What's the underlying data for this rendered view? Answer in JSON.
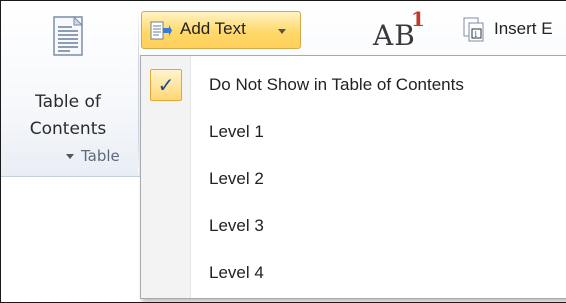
{
  "ribbon": {
    "toc_button": {
      "line1": "Table of",
      "line2": "Contents",
      "icon": "table-of-contents-icon"
    },
    "group_label": "Table",
    "add_text_button": {
      "label": "Add Text",
      "icon": "add-text-icon"
    },
    "footnote_glyph": {
      "text": "AB",
      "superscript": "1",
      "icon": "insert-footnote-icon"
    },
    "insert_button": {
      "label": "Insert E",
      "icon": "insert-endnote-icon"
    }
  },
  "menu": {
    "items": [
      {
        "label": "Do Not Show in Table of Contents",
        "checked": true
      },
      {
        "label": "Level 1",
        "checked": false
      },
      {
        "label": "Level 2",
        "checked": false
      },
      {
        "label": "Level 3",
        "checked": false
      },
      {
        "label": "Level 4",
        "checked": false
      }
    ],
    "check_glyph": "✓"
  },
  "colors": {
    "highlight": "#ffd96b",
    "highlight_border": "#d7a94a",
    "menu_border": "#a7abb0",
    "superscript_red": "#c0392b"
  }
}
